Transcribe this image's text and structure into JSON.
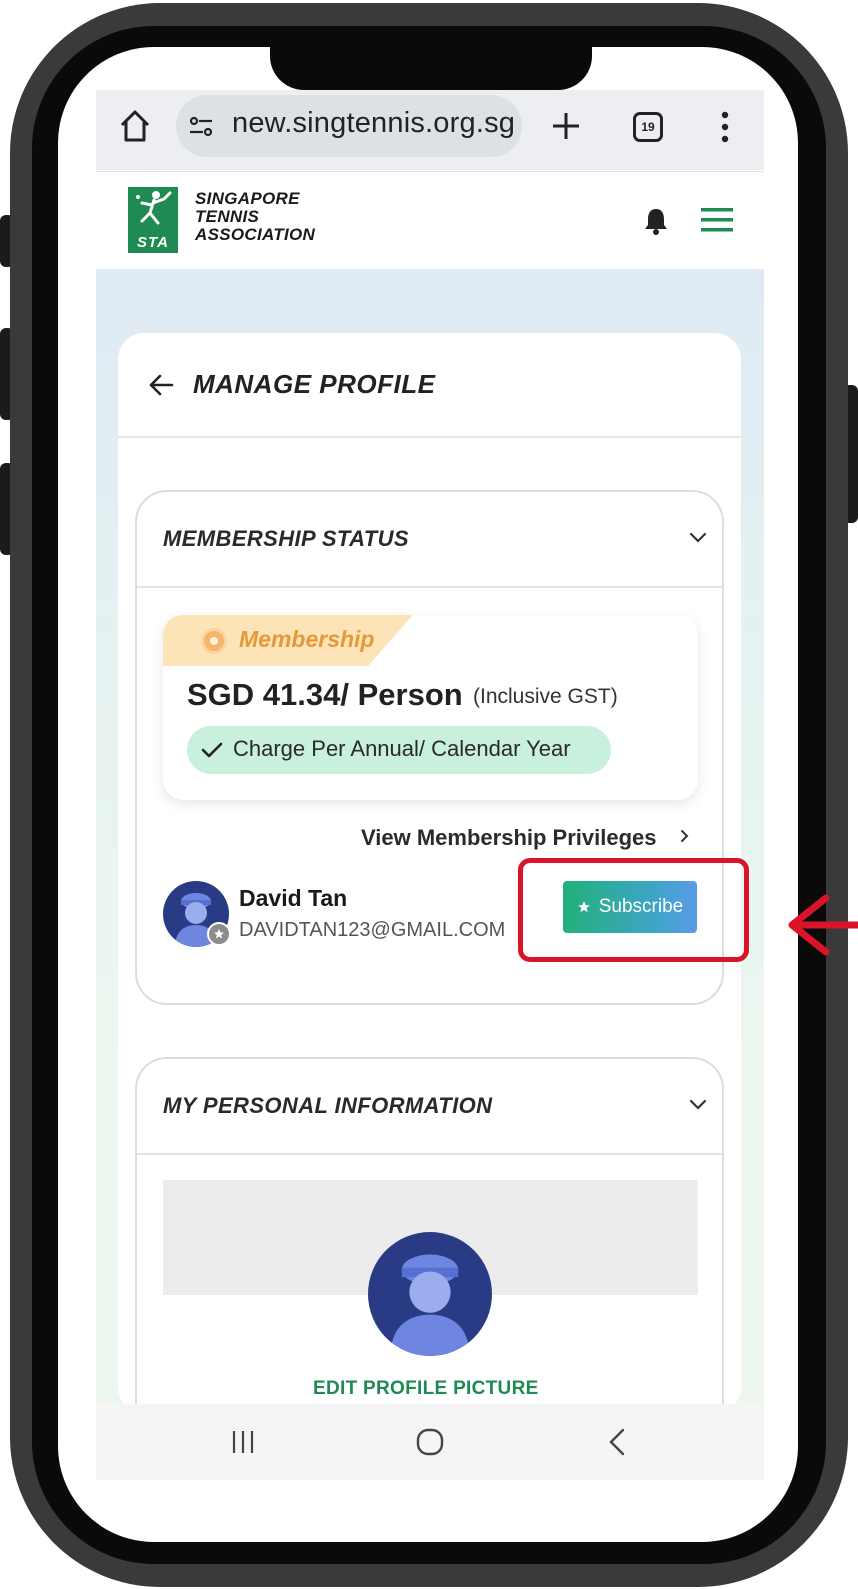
{
  "browser": {
    "url": "new.singtennis.org.sg",
    "tab_count": "19",
    "icons": [
      "home-icon",
      "site-settings-icon",
      "new-tab-plus-icon",
      "tabs-counter-icon",
      "more-menu-icon"
    ]
  },
  "site": {
    "brand_line1": "SINGAPORE",
    "brand_line2": "TENNIS",
    "brand_line3": "ASSOCIATION",
    "logo_text": "STA",
    "accent_color": "#1f8a52"
  },
  "page": {
    "title": "MANAGE PROFILE"
  },
  "membership_section": {
    "title": "MEMBERSHIP STATUS",
    "tag": "Membership",
    "price": "SGD 41.34/ Person",
    "price_note": "(Inclusive GST)",
    "charge_text": "Charge Per Annual/ Calendar Year",
    "privileges_link": "View Membership Privileges"
  },
  "user": {
    "name": "David Tan",
    "email": "DAVIDTAN123@GMAIL.COM"
  },
  "subscribe": {
    "label": "Subscribe"
  },
  "personal_section": {
    "title": "MY PERSONAL INFORMATION",
    "edit_picture": "EDIT PROFILE PICTURE"
  },
  "annotation": {
    "highlight_color": "#d91428"
  }
}
